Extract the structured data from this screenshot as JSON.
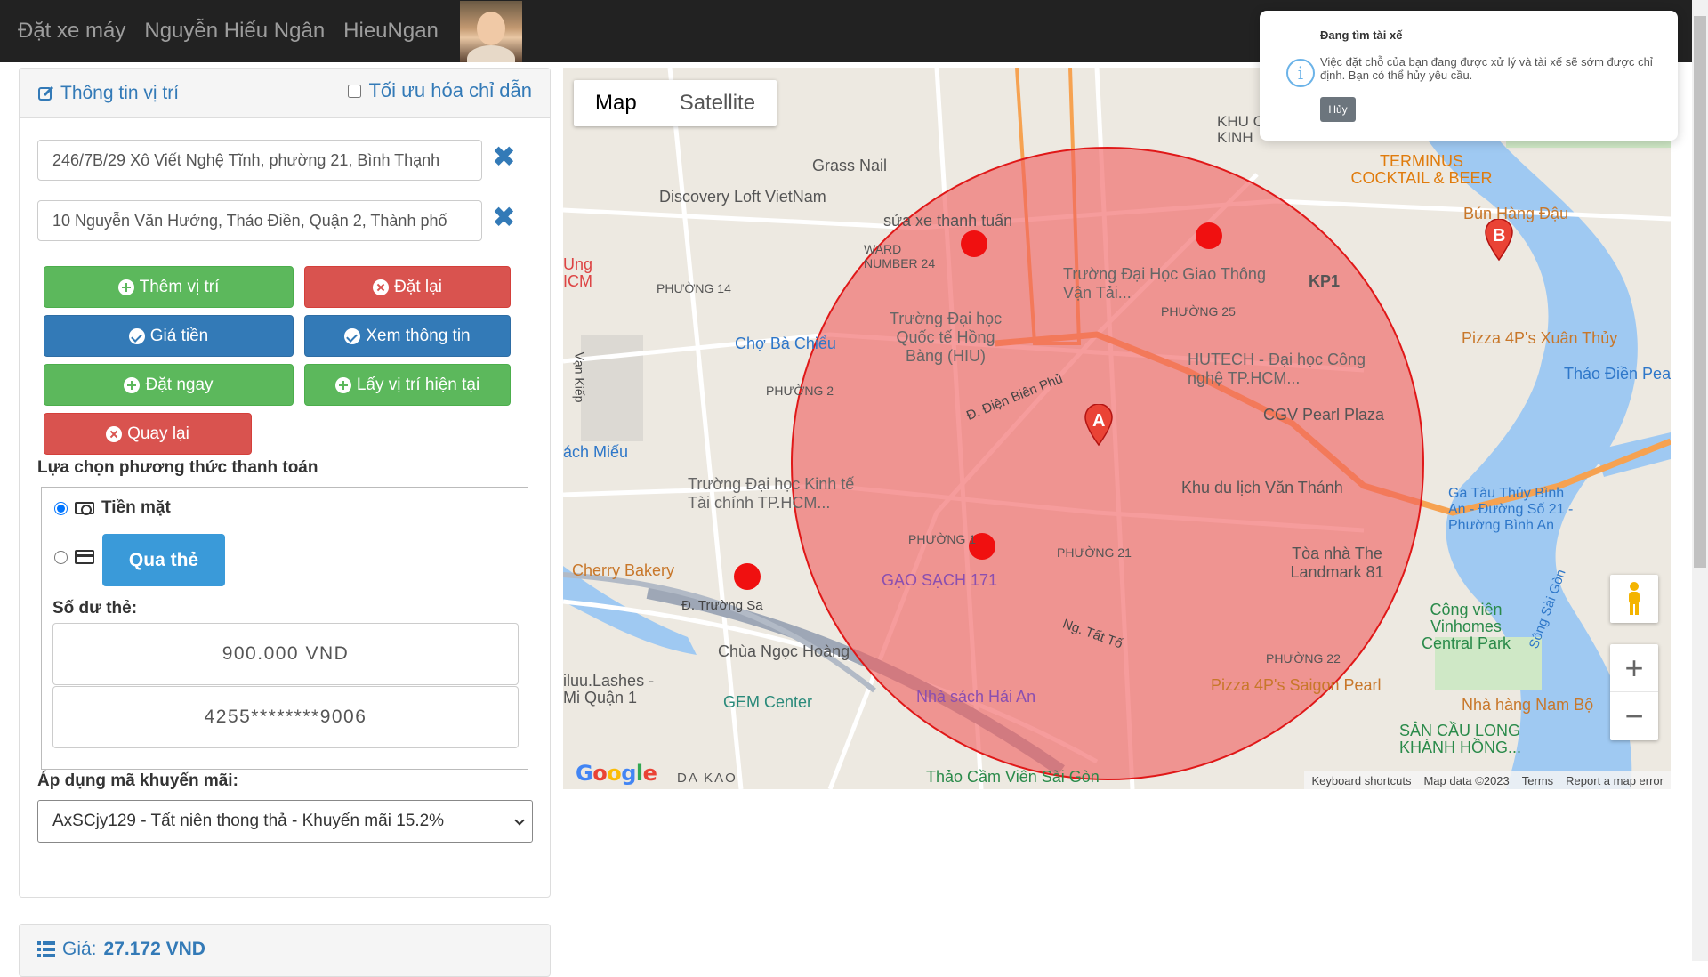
{
  "navbar": {
    "brand": "Đặt xe máy",
    "user_name": "Nguyễn Hiếu Ngân",
    "username": "HieuNgan"
  },
  "location_panel": {
    "title": "Thông tin vị trí",
    "optimize_label": "Tối ưu hóa chỉ dẫn",
    "optimize_checked": false,
    "origin": "246/7B/29 Xô Viết Nghệ Tĩnh, phường 21, Bình Thạnh",
    "destination": "10 Nguyễn Văn Hưởng, Thảo Điền, Quận 2, Thành phố",
    "buttons": {
      "add_location": "Thêm vị trí",
      "reset": "Đặt lại",
      "price": "Giá tiền",
      "view_info": "Xem thông tin",
      "book_now": "Đặt ngay",
      "current_location": "Lấy vị trí hiện tại",
      "back": "Quay lại"
    }
  },
  "payment": {
    "label": "Lựa chọn phương thức thanh toán",
    "cash_label": "Tiền mặt",
    "cash_selected": true,
    "card_button": "Qua thẻ",
    "balance_label": "Số dư thẻ:",
    "balance": "900.000 VND",
    "card_number": "4255********9006"
  },
  "promo": {
    "label": "Áp dụng mã khuyến mãi:",
    "selected": "AxSCjy129 - Tất niên thong thả - Khuyến mãi 15.2%"
  },
  "price": {
    "label": "Giá:",
    "value": "27.172 VND"
  },
  "map": {
    "type_map": "Map",
    "type_satellite": "Satellite",
    "marker_a": "A",
    "marker_b": "B",
    "zoom_in": "+",
    "zoom_out": "−",
    "google": "Google",
    "footer": {
      "shortcuts": "Keyboard shortcuts",
      "data": "Map data ©2023",
      "terms": "Terms",
      "report": "Report a map error"
    },
    "labels": {
      "grass_nail": "Grass Nail",
      "discovery_loft": "Discovery Loft VietNam",
      "sua_xe": "sửa xe thanh tuấn",
      "ward24": "WARD NUMBER 24",
      "phuong14": "PHƯỜNG 14",
      "cho_ba_chieu": "Chợ Bà Chiểu",
      "hiu": "Trường Đại học Quốc tế Hồng Bàng (HIU)",
      "gtvt": "Trường Đại Học Giao Thông Vận Tải...",
      "kp1": "KP1",
      "phuong25": "PHƯỜNG 25",
      "hutech": "HUTECH - Đại học Công nghệ TP.HCM...",
      "phuong2": "PHƯỜNG 2",
      "dien_bien_phu": "Đ. Điện Biên Phủ",
      "cgv": "CGV Pearl Plaza",
      "van_thanh": "Khu du lịch Văn Thánh",
      "ktc": "Trường Đại học Kinh tế Tài chính TP.HCM...",
      "phuong21": "PHƯỜNG 21",
      "phuong1": "PHƯỜNG 1",
      "gao_sach": "GẠO SẠCH 171",
      "landmark": "Tòa nhà The Landmark 81",
      "cherry": "Cherry Bakery",
      "truong_sa": "Đ. Trường Sa",
      "chua_ngoc_hoang": "Chùa Ngọc Hoàng",
      "gem": "GEM Center",
      "hai_an": "Nhà sách Hải An",
      "pizza_sgp": "Pizza 4P's Saigon Pearl",
      "phuong22": "PHƯỜNG 22",
      "thao_cam_vien": "Thảo Cầm Viên Sài Gòn",
      "da_kao": "DA KAO",
      "terminus": "TERMINUS COCKTAIL & BEER",
      "bun_hang_dau": "Bún Hàng Đậu",
      "pizza_xt": "Pizza 4P's Xuân Thủy",
      "thao_dien": "Thảo Điền Pea",
      "vinhomes": "Công viên Vinhomes Central Park",
      "nha_hang_nb": "Nhà hàng Nam Bộ",
      "cau_sg": "SÂN CẦU LONG KHÁNH HỒNG...",
      "ga_tau": "Ga Tàu Thủy Bình An - Đường Số 21 - Phường Bình An",
      "khu_cau_kinh": "KHU CẦU KINH",
      "song_sg": "Sông Sài Gòn",
      "ng_tat_to": "Ng. Tất Tố",
      "ung": "Ung ICM",
      "van_kiep": "Vạn Kiếp",
      "ach_mieu": "ách Miếu",
      "lashes": "iluu.Lashes - Mi Quận 1"
    }
  },
  "toast": {
    "title": "Đang tìm tài xế",
    "body": "Việc đặt chỗ của bạn đang được xử lý và tài xế sẽ sớm được chỉ định. Bạn có thể hủy yêu cầu.",
    "cancel": "Hủy"
  },
  "colors": {
    "navbar_bg": "#222222",
    "primary": "#337ab7",
    "success": "#5cb85c",
    "danger": "#d9534f",
    "card_button": "#3a9ad9",
    "search_circle": "#f06060"
  }
}
